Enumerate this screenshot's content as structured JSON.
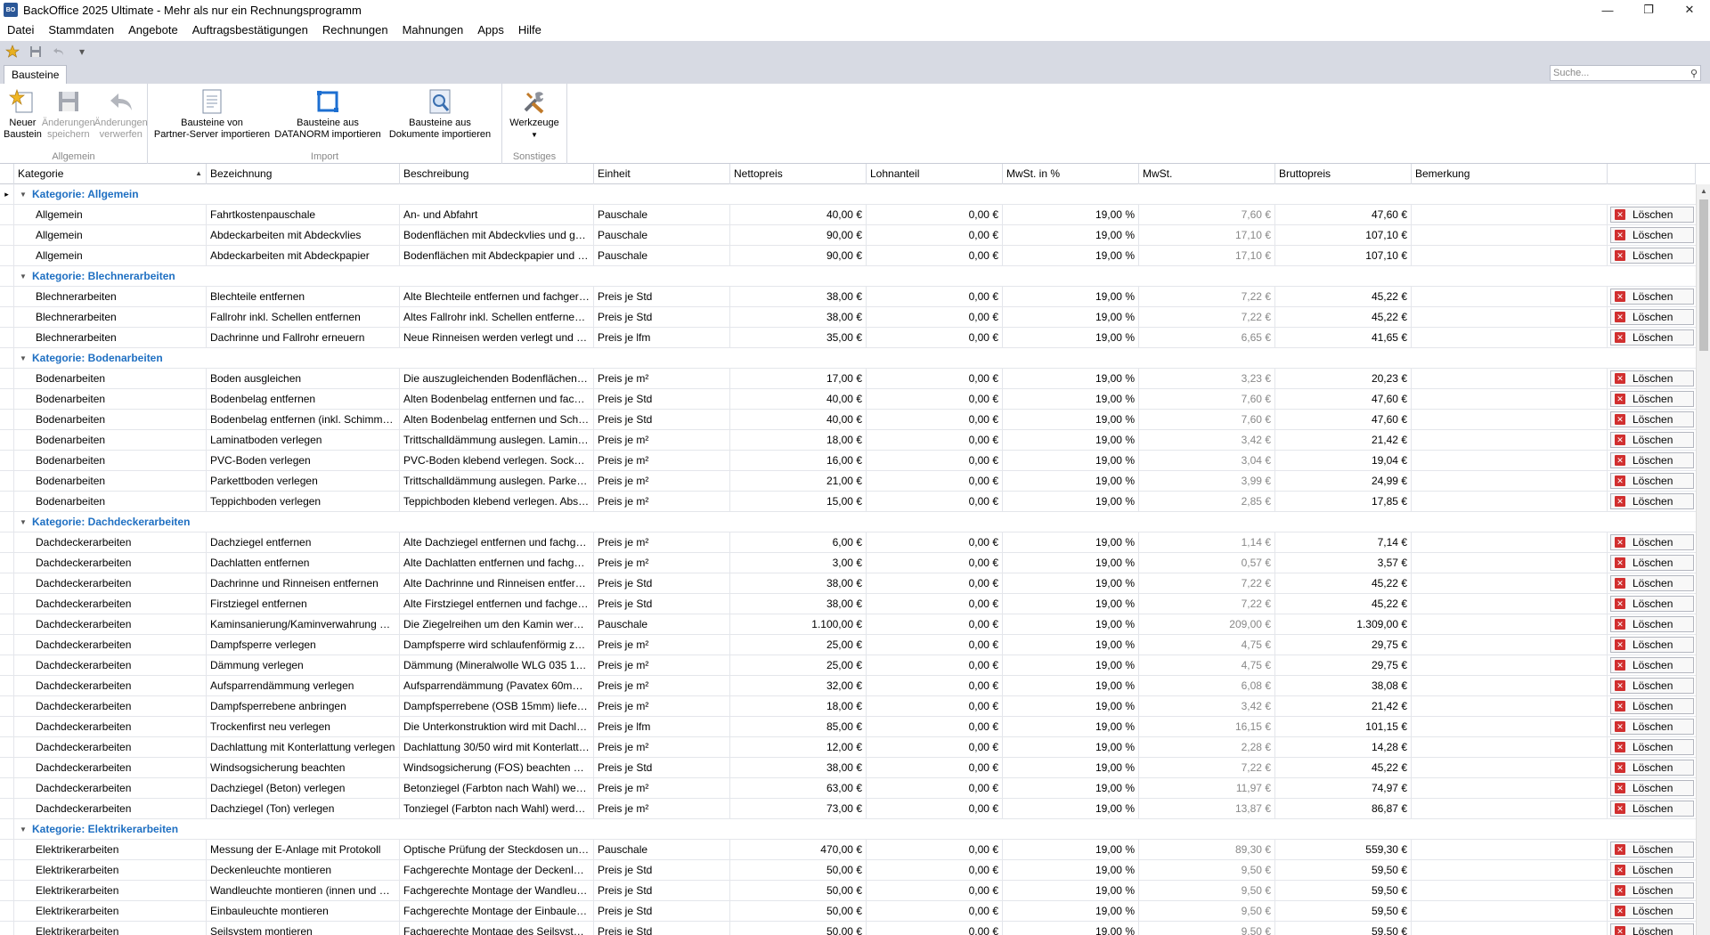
{
  "window": {
    "title": "BackOffice 2025 Ultimate - Mehr als nur ein Rechnungsprogramm",
    "icon_text": "BO"
  },
  "menu": [
    "Datei",
    "Stammdaten",
    "Angebote",
    "Auftragsbestätigungen",
    "Rechnungen",
    "Mahnungen",
    "Apps",
    "Hilfe"
  ],
  "ribbon_tab": "Bausteine",
  "search_placeholder": "Suche...",
  "ribbon": {
    "allgemein": {
      "label": "Allgemein",
      "new": "Neuer\nBaustein",
      "save": "Änderungen\nspeichern",
      "discard": "Änderungen\nverwerfen"
    },
    "import": {
      "label": "Import",
      "partner": "Bausteine von\nPartner-Server importieren",
      "datanorm": "Bausteine aus\nDATANORM importieren",
      "docs": "Bausteine aus\nDokumente importieren"
    },
    "sonstiges": {
      "label": "Sonstiges",
      "tools": "Werkzeuge"
    }
  },
  "columns": [
    "Kategorie",
    "Bezeichnung",
    "Beschreibung",
    "Einheit",
    "Nettopreis",
    "Lohnanteil",
    "MwSt. in %",
    "MwSt.",
    "Bruttopreis",
    "Bemerkung"
  ],
  "delete_label": "Löschen",
  "groups": [
    {
      "title": "Kategorie: Allgemein",
      "rows": [
        [
          "Allgemein",
          "Fahrtkostenpauschale",
          "An- und Abfahrt",
          "Pauschale",
          "40,00 €",
          "0,00 €",
          "19,00 %",
          "7,60 €",
          "47,60 €"
        ],
        [
          "Allgemein",
          "Abdeckarbeiten mit Abdeckvlies",
          "Bodenflächen mit Abdeckvlies und ggfs. ...",
          "Pauschale",
          "90,00 €",
          "0,00 €",
          "19,00 %",
          "17,10 €",
          "107,10 €"
        ],
        [
          "Allgemein",
          "Abdeckarbeiten mit Abdeckpapier",
          "Bodenflächen mit Abdeckpapier und ggfs....",
          "Pauschale",
          "90,00 €",
          "0,00 €",
          "19,00 %",
          "17,10 €",
          "107,10 €"
        ]
      ]
    },
    {
      "title": "Kategorie: Blechnerarbeiten",
      "rows": [
        [
          "Blechnerarbeiten",
          "Blechteile entfernen",
          "Alte Blechteile entfernen und fachgerecht...",
          "Preis je Std",
          "38,00 €",
          "0,00 €",
          "19,00 %",
          "7,22 €",
          "45,22 €"
        ],
        [
          "Blechnerarbeiten",
          "Fallrohr inkl. Schellen entfernen",
          "Altes Fallrohr inkl. Schellen entfernen und...",
          "Preis je Std",
          "38,00 €",
          "0,00 €",
          "19,00 %",
          "7,22 €",
          "45,22 €"
        ],
        [
          "Blechnerarbeiten",
          "Dachrinne und Fallrohr erneuern",
          "Neue Rinneisen werden verlegt und das ...",
          "Preis je lfm",
          "35,00 €",
          "0,00 €",
          "19,00 %",
          "6,65 €",
          "41,65 €"
        ]
      ]
    },
    {
      "title": "Kategorie: Bodenarbeiten",
      "rows": [
        [
          "Bodenarbeiten",
          "Boden ausgleichen",
          "Die auszugleichenden Bodenflächen mit ei...",
          "Preis je m²",
          "17,00 €",
          "0,00 €",
          "19,00 %",
          "3,23 €",
          "20,23 €"
        ],
        [
          "Bodenarbeiten",
          "Bodenbelag entfernen",
          "Alten Bodenbelag entfernen und fachger...",
          "Preis je Std",
          "40,00 €",
          "0,00 €",
          "19,00 %",
          "7,60 €",
          "47,60 €"
        ],
        [
          "Bodenarbeiten",
          "Bodenbelag entfernen (inkl. Schimmelbeh...",
          "Alten Bodenbelag entfernen und Schimme...",
          "Preis je Std",
          "40,00 €",
          "0,00 €",
          "19,00 %",
          "7,60 €",
          "47,60 €"
        ],
        [
          "Bodenarbeiten",
          "Laminatboden verlegen",
          "Trittschalldämmung auslegen. Laminat sc...",
          "Preis je m²",
          "18,00 €",
          "0,00 €",
          "19,00 %",
          "3,42 €",
          "21,42 €"
        ],
        [
          "Bodenarbeiten",
          "PVC-Boden verlegen",
          "PVC-Boden klebend verlegen. Sockelleiste...",
          "Preis je m²",
          "16,00 €",
          "0,00 €",
          "19,00 %",
          "3,04 €",
          "19,04 €"
        ],
        [
          "Bodenarbeiten",
          "Parkettboden verlegen",
          "Trittschalldämmung auslegen. Parkett sch...",
          "Preis je m²",
          "21,00 €",
          "0,00 €",
          "19,00 %",
          "3,99 €",
          "24,99 €"
        ],
        [
          "Bodenarbeiten",
          "Teppichboden verlegen",
          "Teppichboden klebend verlegen. Abschlu...",
          "Preis je m²",
          "15,00 €",
          "0,00 €",
          "19,00 %",
          "2,85 €",
          "17,85 €"
        ]
      ]
    },
    {
      "title": "Kategorie: Dachdeckerarbeiten",
      "rows": [
        [
          "Dachdeckerarbeiten",
          "Dachziegel entfernen",
          "Alte Dachziegel entfernen und fachgerec...",
          "Preis je m²",
          "6,00 €",
          "0,00 €",
          "19,00 %",
          "1,14 €",
          "7,14 €"
        ],
        [
          "Dachdeckerarbeiten",
          "Dachlatten entfernen",
          "Alte Dachlatten entfernen und fachgerec...",
          "Preis je m²",
          "3,00 €",
          "0,00 €",
          "19,00 %",
          "0,57 €",
          "3,57 €"
        ],
        [
          "Dachdeckerarbeiten",
          "Dachrinne und Rinneisen entfernen",
          "Alte Dachrinne und Rinneisen entfernen u...",
          "Preis je Std",
          "38,00 €",
          "0,00 €",
          "19,00 %",
          "7,22 €",
          "45,22 €"
        ],
        [
          "Dachdeckerarbeiten",
          "Firstziegel entfernen",
          "Alte Firstziegel entfernen und fachgerech...",
          "Preis je Std",
          "38,00 €",
          "0,00 €",
          "19,00 %",
          "7,22 €",
          "45,22 €"
        ],
        [
          "Dachdeckerarbeiten",
          "Kaminsanierung/Kaminverwahrung mit Ble...",
          "Die Ziegelreihen um den Kamin werden en...",
          "Pauschale",
          "1.100,00 €",
          "0,00 €",
          "19,00 %",
          "209,00 €",
          "1.309,00 €"
        ],
        [
          "Dachdeckerarbeiten",
          "Dampfsperre verlegen",
          "Dampfsperre wird schlaufenförmig zwisch...",
          "Preis je m²",
          "25,00 €",
          "0,00 €",
          "19,00 %",
          "4,75 €",
          "29,75 €"
        ],
        [
          "Dachdeckerarbeiten",
          "Dämmung verlegen",
          "Dämmung (Mineralwolle WLG 035 100mm)...",
          "Preis je m²",
          "25,00 €",
          "0,00 €",
          "19,00 %",
          "4,75 €",
          "29,75 €"
        ],
        [
          "Dachdeckerarbeiten",
          "Aufsparrendämmung verlegen",
          "Aufsparrendämmung (Pavatex 60mm) wir...",
          "Preis je m²",
          "32,00 €",
          "0,00 €",
          "19,00 %",
          "6,08 €",
          "38,08 €"
        ],
        [
          "Dachdeckerarbeiten",
          "Dampfsperrebene anbringen",
          "Dampfsperrebene (OSB 15mm) liefern un...",
          "Preis je m²",
          "18,00 €",
          "0,00 €",
          "19,00 %",
          "3,42 €",
          "21,42 €"
        ],
        [
          "Dachdeckerarbeiten",
          "Trockenfirst neu verlegen",
          "Die Unterkonstruktion wird mit Dachlattun...",
          "Preis je lfm",
          "85,00 €",
          "0,00 €",
          "19,00 %",
          "16,15 €",
          "101,15 €"
        ],
        [
          "Dachdeckerarbeiten",
          "Dachlattung mit Konterlattung verlegen",
          "Dachlattung 30/50 wird mit Konterlattung...",
          "Preis je m²",
          "12,00 €",
          "0,00 €",
          "19,00 %",
          "2,28 €",
          "14,28 €"
        ],
        [
          "Dachdeckerarbeiten",
          "Windsogsicherung beachten",
          "Windsogsicherung (FOS) beachten und T...",
          "Preis je Std",
          "38,00 €",
          "0,00 €",
          "19,00 %",
          "7,22 €",
          "45,22 €"
        ],
        [
          "Dachdeckerarbeiten",
          "Dachziegel (Beton) verlegen",
          "Betonziegel (Farbton nach Wahl) werden ...",
          "Preis je m²",
          "63,00 €",
          "0,00 €",
          "19,00 %",
          "11,97 €",
          "74,97 €"
        ],
        [
          "Dachdeckerarbeiten",
          "Dachziegel (Ton) verlegen",
          "Tonziegel (Farbton nach Wahl) werden g...",
          "Preis je m²",
          "73,00 €",
          "0,00 €",
          "19,00 %",
          "13,87 €",
          "86,87 €"
        ]
      ]
    },
    {
      "title": "Kategorie: Elektrikerarbeiten",
      "rows": [
        [
          "Elektrikerarbeiten",
          "Messung der E-Anlage mit Protokoll",
          "Optische Prüfung der Steckdosen und Lic...",
          "Pauschale",
          "470,00 €",
          "0,00 €",
          "19,00 %",
          "89,30 €",
          "559,30 €"
        ],
        [
          "Elektrikerarbeiten",
          "Deckenleuchte montieren",
          "Fachgerechte Montage der Deckenleucht...",
          "Preis je Std",
          "50,00 €",
          "0,00 €",
          "19,00 %",
          "9,50 €",
          "59,50 €"
        ],
        [
          "Elektrikerarbeiten",
          "Wandleuchte montieren (innen und außen)",
          "Fachgerechte Montage der Wandleuchte ...",
          "Preis je Std",
          "50,00 €",
          "0,00 €",
          "19,00 %",
          "9,50 €",
          "59,50 €"
        ],
        [
          "Elektrikerarbeiten",
          "Einbauleuchte montieren",
          "Fachgerechte Montage der Einbauleuchte...",
          "Preis je Std",
          "50,00 €",
          "0,00 €",
          "19,00 %",
          "9,50 €",
          "59,50 €"
        ],
        [
          "Elektrikerarbeiten",
          "Seilsystem montieren",
          "Fachgerechte Montage des Seilsystems a...",
          "Preis je Std",
          "50,00 €",
          "0,00 €",
          "19,00 %",
          "9,50 €",
          "59,50 €"
        ]
      ]
    }
  ]
}
